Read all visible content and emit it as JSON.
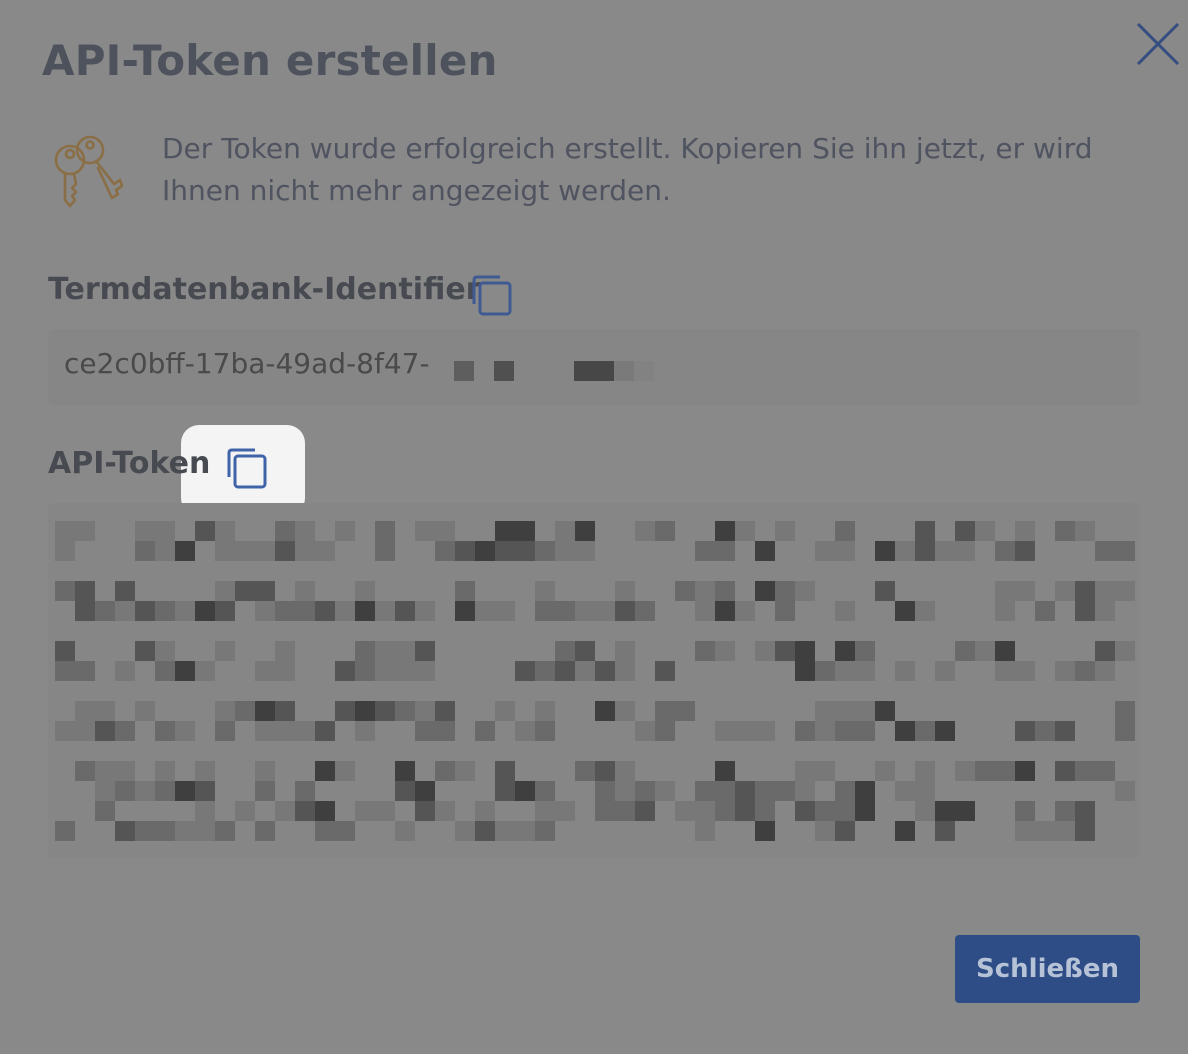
{
  "dialog": {
    "title": "API-Token erstellen",
    "close_icon": "close-icon",
    "info_icon": "keys-icon",
    "info_text": "Der Token wurde erfolgreich erstellt. Kopieren Sie ihn jetzt, er wird Ihnen nicht mehr angezeigt werden."
  },
  "identifier": {
    "label": "Termdatenbank-Identifier",
    "value_visible": "ce2c0bff-17ba-49ad-8f47-",
    "value_state": "partially-redacted",
    "copy_icon": "copy-icon"
  },
  "token": {
    "label": "API-Token",
    "value_state": "redacted",
    "copy_icon": "copy-icon"
  },
  "footer": {
    "close_button_label": "Schließen"
  },
  "colors": {
    "overlay": "#898989",
    "accent": "#2e4d87",
    "icon_blue": "#3f5a93",
    "keys_gold": "#8a6e45"
  }
}
